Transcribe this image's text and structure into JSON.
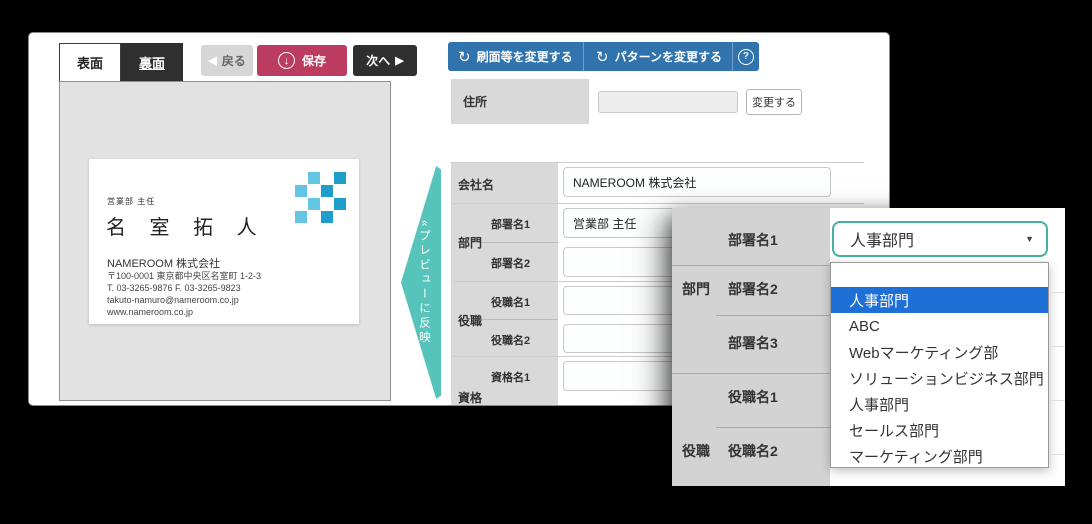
{
  "colors": {
    "accent_blue": "#3173ad",
    "save_red": "#bc3c61",
    "dark_button": "#2f2f2f",
    "teal_arrow": "#57c4bb",
    "select_focus_teal": "#43b0a2",
    "dropdown_selected_blue": "#1e6fd6",
    "logo_light_blue": "#64c5e2",
    "logo_dark_blue": "#1f9ecb",
    "label_cell_gray": "#d9d9d9"
  },
  "icons": {
    "back_arrow": "◀",
    "next_arrow": "▶",
    "download_arrow": "↓",
    "refresh": "↻",
    "help": "?",
    "select_caret": "▼"
  },
  "tabs": {
    "front": "表面",
    "back": "裏面"
  },
  "toolbar": {
    "back": "戻る",
    "save": "保存",
    "next": "次へ"
  },
  "actions": {
    "change_print": "刷面等を変更する",
    "change_pattern": "パターンを変更する"
  },
  "address": {
    "label": "住所",
    "value": "",
    "change_button": "変更する"
  },
  "preview": {
    "arrow_label": "«プレビューに反映",
    "card": {
      "dept_title": "営業部 主任",
      "name": "名 室 拓 人",
      "company": "NAMEROOM 株式会社",
      "address": "〒100-0001 東京都中央区名室町 1-2-3",
      "phone": "T. 03-3265-9876 F. 03-3265-9823",
      "email": "takuto-namuro@nameroom.co.jp",
      "website": "www.nameroom.co.jp"
    }
  },
  "form": {
    "company": {
      "label": "会社名",
      "value": "NAMEROOM 株式会社"
    },
    "groups": {
      "department": "部門",
      "position": "役職",
      "qualification": "資格"
    },
    "fields": {
      "dept1": {
        "label": "部署名1",
        "value": "営業部 主任"
      },
      "dept2": {
        "label": "部署名2",
        "value": ""
      },
      "pos1": {
        "label": "役職名1",
        "value": ""
      },
      "pos2": {
        "label": "役職名2",
        "value": ""
      },
      "qual1": {
        "label": "資格名1",
        "value": ""
      }
    }
  },
  "overlay": {
    "groups": {
      "department": "部門",
      "position": "役職"
    },
    "labels": {
      "dept1": "部署名1",
      "dept2": "部署名2",
      "dept3": "部署名3",
      "pos1": "役職名1",
      "pos2": "役職名2"
    },
    "select": {
      "value": "人事部門"
    },
    "dropdown": {
      "selected_index": 1,
      "options": [
        "",
        "人事部門",
        "ABC",
        "Webマーケティング部",
        "ソリューションビジネス部門",
        "人事部門",
        "セールス部門",
        "マーケティング部門"
      ]
    }
  }
}
